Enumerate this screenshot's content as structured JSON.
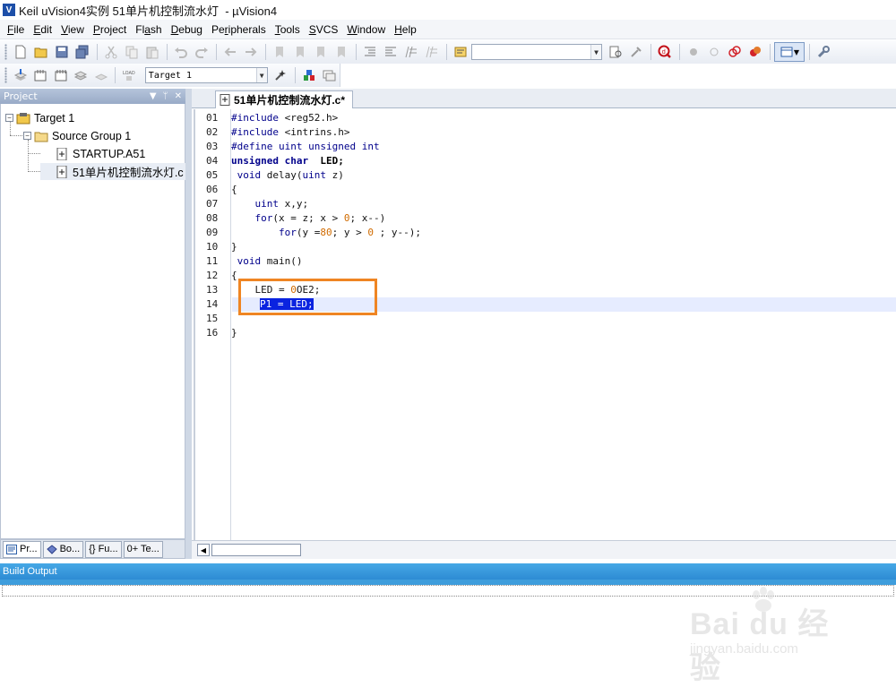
{
  "window": {
    "title": "Keil uVision4实例 51单片机控制流水灯  - µVision4",
    "icon_letter": "V"
  },
  "menu": [
    {
      "label": "File",
      "u": "F",
      "rest": "ile"
    },
    {
      "label": "Edit",
      "u": "E",
      "rest": "dit"
    },
    {
      "label": "View",
      "u": "V",
      "rest": "iew"
    },
    {
      "label": "Project",
      "u": "P",
      "rest": "roject"
    },
    {
      "label": "Flash",
      "u": "",
      "pre": "Fl",
      "u2": "a",
      "rest": "sh"
    },
    {
      "label": "Debug",
      "u": "D",
      "rest": "ebug"
    },
    {
      "label": "Peripherals",
      "u": "",
      "pre": "Pe",
      "u2": "r",
      "rest": "ipherals"
    },
    {
      "label": "Tools",
      "u": "T",
      "rest": "ools"
    },
    {
      "label": "SVCS",
      "u": "S",
      "rest": "VCS"
    },
    {
      "label": "Window",
      "u": "W",
      "rest": "indow"
    },
    {
      "label": "Help",
      "u": "H",
      "rest": "elp"
    }
  ],
  "toolbar2": {
    "target_combo": "Target 1"
  },
  "project_panel": {
    "title": "Project",
    "tree": {
      "target": "Target 1",
      "group": "Source Group 1",
      "files": [
        "STARTUP.A51",
        "51单片机控制流水灯.c"
      ]
    },
    "tabs": [
      "Pr...",
      "Bo...",
      "{} Fu...",
      "0+ Te..."
    ]
  },
  "editor": {
    "tab_label": "51单片机控制流水灯.c*",
    "lines": [
      {
        "n": "01",
        "code": "#include <reg52.h>"
      },
      {
        "n": "02",
        "code": "#include <intrins.h>"
      },
      {
        "n": "03",
        "code": "#define uint unsigned int"
      },
      {
        "n": "04",
        "code": "unsigned char  LED;"
      },
      {
        "n": "05",
        "code": " void delay(uint z)"
      },
      {
        "n": "06",
        "code": "{"
      },
      {
        "n": "07",
        "code": "    uint x,y;"
      },
      {
        "n": "08",
        "code": "    for(x = z; x > 0; x--)"
      },
      {
        "n": "09",
        "code": "        for(y =80; y > 0 ; y--);"
      },
      {
        "n": "10",
        "code": "}"
      },
      {
        "n": "11",
        "code": " void main()"
      },
      {
        "n": "12",
        "code": "{"
      },
      {
        "n": "13",
        "code": "    LED = 0OE2;"
      },
      {
        "n": "14",
        "code": "    P1 = LED;"
      },
      {
        "n": "15",
        "code": ""
      },
      {
        "n": "16",
        "code": "}"
      }
    ],
    "current_line": "14"
  },
  "build_output": {
    "title": "Build Output"
  },
  "watermark": {
    "main": "Bai du 经验",
    "sub": "jingyan.baidu.com"
  },
  "colors": {
    "keyword": "#00008b",
    "number": "#d06b00",
    "selection": "#0a23e0",
    "annotation_box": "#ef8523",
    "build_header": "#2d8bd4"
  }
}
